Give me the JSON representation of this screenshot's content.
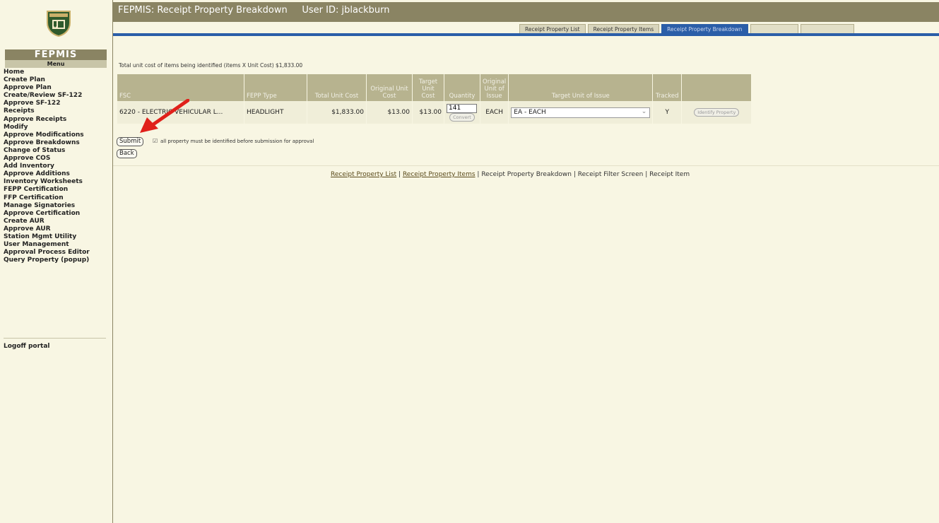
{
  "sidebar": {
    "title": "FEPMIS",
    "menu_label": "Menu",
    "items": [
      "Home",
      "Create Plan",
      "Approve Plan",
      "Create/Review SF-122",
      "Approve SF-122",
      "Receipts",
      "Approve Receipts",
      "Modify",
      "Approve Modifications",
      "Approve Breakdowns",
      "Change of Status",
      "Approve COS",
      "Add Inventory",
      "Approve Additions",
      "Inventory Worksheets",
      "FEPP Certification",
      "FFP Certification",
      "Manage Signatories",
      "Approve Certification",
      "Create AUR",
      "Approve AUR",
      "Station Mgmt Utility",
      "User Management",
      "Approval Process Editor",
      "Query Property (popup)"
    ],
    "logoff": "Logoff portal"
  },
  "header": {
    "title": "FEPMIS: Receipt Property Breakdown     User ID: jblackburn"
  },
  "tabs": [
    "Receipt Property List",
    "Receipt Property Items",
    "Receipt Property Breakdown"
  ],
  "summary": "Total unit cost of items being identified (items X Unit Cost) $1,833.00",
  "table": {
    "headers": {
      "fsc": "FSC",
      "fepp_type": "FEPP Type",
      "total_unit_cost": "Total Unit Cost",
      "original_unit_cost": "Original Unit Cost",
      "target_unit_cost": "Target Unit Cost",
      "quantity": "Quantity",
      "original_unit_issue": "Original Unit of Issue",
      "target_unit_issue": "Target Unit of Issue",
      "tracked": "Tracked"
    },
    "row": {
      "fsc": "6220 - ELECTRIC VEHICULAR L...",
      "fepp_type": "HEADLIGHT",
      "total_unit_cost": "$1,833.00",
      "original_unit_cost": "$13.00",
      "target_unit_cost": "$13.00",
      "quantity": "141",
      "convert": "Convert",
      "original_unit_issue": "EACH",
      "target_unit_issue": "EA - EACH",
      "tracked": "Y",
      "identify": "Identify Property"
    }
  },
  "actions": {
    "submit": "Submit",
    "checkbox_note": "all property must be identified before submission for approval",
    "back": "Back"
  },
  "bottom_links": {
    "l1": "Receipt Property List",
    "l2": "Receipt Property Items",
    "l3": "Receipt Property Breakdown",
    "l4": "Receipt Filter Screen",
    "l5": "Receipt Item"
  },
  "colors": {
    "header": "#8a8463",
    "accent_blue": "#2b5ea8",
    "background": "#f8f6e3",
    "arrow": "#e0201a"
  }
}
